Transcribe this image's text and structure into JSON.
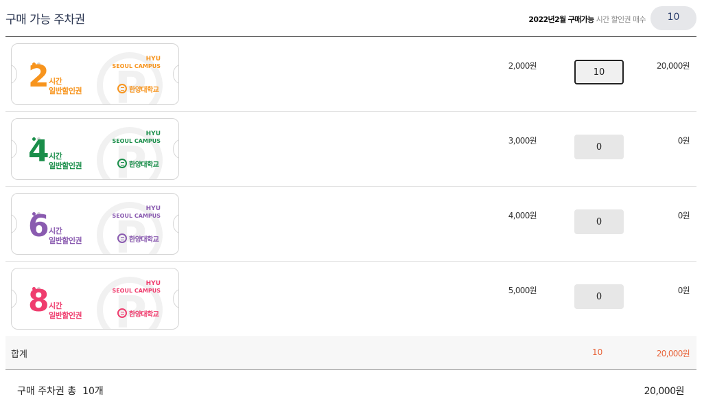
{
  "header": {
    "title": "구매 가능 주차권",
    "limit_year_month": "2022년2월",
    "limit_bold_label": "구매가능",
    "limit_label": "시간 할인권 매수",
    "limit_count": "10"
  },
  "colors": {
    "orange": "#f7941d",
    "green": "#1a8e4a",
    "purple": "#8a5bb0",
    "pink": "#ef3d6e",
    "accent": "#e8643a"
  },
  "tickets": [
    {
      "hours_number": "2",
      "hours_label": "시간",
      "type_label": "일반할인권",
      "hyu": "HYU",
      "campus": "SEOUL CAMPUS",
      "university": "한양대학교",
      "icon": "hanyang-emblem-icon",
      "color": "#f7941d",
      "price": "2,000원",
      "quantity": "10",
      "subtotal": "20,000원"
    },
    {
      "hours_number": "4",
      "hours_label": "시간",
      "type_label": "일반할인권",
      "hyu": "HYU",
      "campus": "SEOUL CAMPUS",
      "university": "한양대학교",
      "icon": "hanyang-emblem-icon",
      "color": "#1a8e4a",
      "price": "3,000원",
      "quantity": "0",
      "subtotal": "0원"
    },
    {
      "hours_number": "6",
      "hours_label": "시간",
      "type_label": "일반할인권",
      "hyu": "HYU",
      "campus": "SEOUL CAMPUS",
      "university": "한양대학교",
      "icon": "hanyang-emblem-icon",
      "color": "#8a5bb0",
      "price": "4,000원",
      "quantity": "0",
      "subtotal": "0원"
    },
    {
      "hours_number": "8",
      "hours_label": "시간",
      "type_label": "일반할인권",
      "hyu": "HYU",
      "campus": "SEOUL CAMPUS",
      "university": "한양대학교",
      "icon": "hanyang-emblem-icon",
      "color": "#ef3d6e",
      "price": "5,000원",
      "quantity": "0",
      "subtotal": "0원"
    }
  ],
  "summary": {
    "label": "합계",
    "quantity": "10",
    "total": "20,000원"
  },
  "footer": {
    "left": "구매 주차권 총  10개",
    "right": "20,000원"
  }
}
